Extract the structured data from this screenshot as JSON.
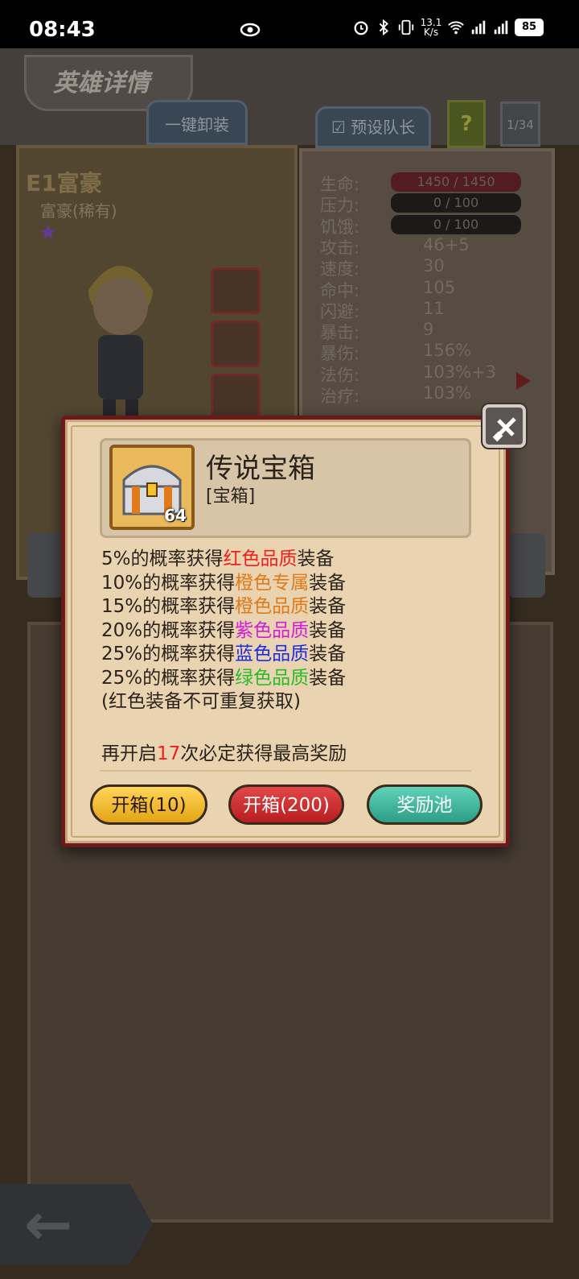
{
  "status_bar": {
    "time": "08:43",
    "net_speed_top": "13.1",
    "net_speed_bottom": "K/s",
    "wifi_badge": "6",
    "signal1_badge": "4G",
    "signal2_badge": "4G",
    "battery": "85",
    "icons": [
      "eye-icon",
      "alarm-icon",
      "bluetooth-icon",
      "vibrate-icon",
      "wifi-icon",
      "signal-icon",
      "signal-icon",
      "battery-icon"
    ]
  },
  "header": {
    "title": "英雄详情",
    "unload_label": "一键卸装",
    "captain_label": "预设队长",
    "help_label": "?",
    "page_count": "1/34"
  },
  "hero": {
    "name": "E1富豪",
    "subtitle": "富豪(稀有)"
  },
  "stats": [
    {
      "label": "生命:",
      "value": "1450 / 1450",
      "kind": "bar-red"
    },
    {
      "label": "压力:",
      "value": "0 / 100",
      "kind": "bar"
    },
    {
      "label": "饥饿:",
      "value": "0 / 100",
      "kind": "bar"
    },
    {
      "label": "攻击:",
      "value": "46+5",
      "kind": "text"
    },
    {
      "label": "速度:",
      "value": "30",
      "kind": "text"
    },
    {
      "label": "命中:",
      "value": "105",
      "kind": "text"
    },
    {
      "label": "闪避:",
      "value": "11",
      "kind": "text"
    },
    {
      "label": "暴击:",
      "value": "9",
      "kind": "text"
    },
    {
      "label": "暴伤:",
      "value": "156%",
      "kind": "text"
    },
    {
      "label": "法伤:",
      "value": "103%+3",
      "kind": "text"
    },
    {
      "label": "治疗:",
      "value": "103%",
      "kind": "text"
    }
  ],
  "popup": {
    "item_name": "传说宝箱",
    "item_type": "[宝箱]",
    "item_quantity": "64",
    "lines": [
      {
        "prefix": "5%的概率获得",
        "highlight": "红色品质",
        "suffix": "装备",
        "color": "#f02020"
      },
      {
        "prefix": "10%的概率获得",
        "highlight": "橙色专属",
        "suffix": "装备",
        "color": "#e07a1a"
      },
      {
        "prefix": "15%的概率获得",
        "highlight": "橙色品质",
        "suffix": "装备",
        "color": "#e07a1a"
      },
      {
        "prefix": "20%的概率获得",
        "highlight": "紫色品质",
        "suffix": "装备",
        "color": "#d41cd8"
      },
      {
        "prefix": "25%的概率获得",
        "highlight": "蓝色品质",
        "suffix": "装备",
        "color": "#1c2ee0"
      },
      {
        "prefix": "25%的概率获得",
        "highlight": "绿色品质",
        "suffix": "装备",
        "color": "#2abb2a"
      }
    ],
    "note": "(红色装备不可重复获取)",
    "guarantee_prefix": "再开启",
    "guarantee_count": "17",
    "guarantee_suffix": "次必定获得最高奖励",
    "buttons": {
      "open10": "开箱(10)",
      "open200": "开箱(200)",
      "pool": "奖励池"
    }
  }
}
